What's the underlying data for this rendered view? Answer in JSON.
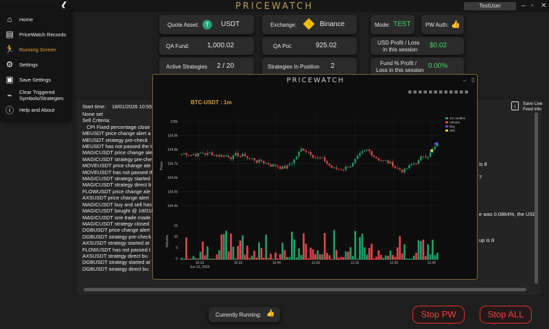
{
  "header": {
    "brand": "PRICEWATCH",
    "user": "TestUser",
    "back_icon": "chevron-left-icon"
  },
  "cards": {
    "quote_asset": {
      "label": "Quote Asset:",
      "value": "USDT"
    },
    "exchange": {
      "label": "Exchange:",
      "value": "Binance"
    },
    "mode": {
      "label": "Mode:",
      "value": "TEST"
    },
    "pw_auth": {
      "label": "PW Auth:"
    },
    "qa_fund": {
      "label": "QA Fund:",
      "value": "1,000.02"
    },
    "qa_pot": {
      "label": "QA Pot:",
      "value": "925.02"
    },
    "usd_pl": {
      "label1": "USD Profit / Loss",
      "label2": "in this session",
      "value": "$0.02"
    },
    "active": {
      "label": "Active Strategies",
      "value": "2 / 20"
    },
    "in_position": {
      "label": "Strategies In Position",
      "value": "2"
    },
    "fund_pl": {
      "label1": "Fund % Profit /",
      "label2": "Loss in this session",
      "value": "0.00%"
    }
  },
  "sidebar": {
    "items": [
      {
        "label": "Home",
        "icon": "home-icon"
      },
      {
        "label": "PriceWatch Records",
        "icon": "document-icon"
      },
      {
        "label": "Running Screen",
        "icon": "runner-icon"
      },
      {
        "label": "Settings",
        "icon": "gear-icon"
      },
      {
        "label": "Save Settings",
        "icon": "save-icon"
      },
      {
        "label1": "Clear Triggered",
        "label2": "Symbols/Strategies",
        "icon": "broom-icon"
      },
      {
        "label": "Help and About",
        "icon": "info-icon"
      }
    ]
  },
  "log": {
    "start_label": "Start time:",
    "start_value": "18/01/2026 10:55:3",
    "lines": [
      "None set",
      "Sell Criteria:",
      "   CPI Fixed percentage close",
      "",
      "",
      "MEUSDT price change alert a",
      "MEUSDT strategy pre-check",
      "MEUSDT has not passed the t",
      "MAGICUSDT price change ale",
      "MAGICUSDT strategy pre-che",
      "MOVEUSDT price change ale",
      "MOVEUSDT has not passed th",
      "MAGICUSDT strategy started",
      "MAGICUSDT strategy direct b",
      "FLOWUSDT price change ale",
      "AXSUSDT price change alert",
      "MAGICUSDT buy and sell has",
      "MAGICUSDT bought @ 18/01/",
      "MAGICUSDT one trade made",
      "MAGICUSDT strategy closed",
      "DGBUSDT price change alert",
      "DGBUSDT strategy pre-check",
      "AXSUSDT strategy started at",
      "FLOWUSDT has not passed t",
      "AXSUSDT strategy direct bu",
      "DGBUSDT strategy started at",
      "DGBUSDT strategy direct bu"
    ],
    "right1": "is 8",
    "right2": "7",
    "right3": "e was 0.0864%, the USD",
    "right4": "up is 8",
    "save_live1": "Save Live",
    "save_live2": "Feed info"
  },
  "chart_window": {
    "title": "PRICEWATCH"
  },
  "chart_data": {
    "type": "candlestick",
    "title": "BTC-USDT : 1m",
    "ylabel": "Price",
    "ylabel2": "Volume",
    "ylim": [
      104450,
      105050
    ],
    "price_ticks": [
      "105k",
      "104.9k",
      "104.8k",
      "104.7k",
      "104.6k",
      "104.5k",
      "104.4k"
    ],
    "vol_ticks": [
      "15",
      "10",
      "5",
      "0"
    ],
    "vol_ylim": [
      0,
      16
    ],
    "x_ticks": [
      "10:15",
      "10:30",
      "10:45",
      "11:00",
      "11:15",
      "11:30",
      "11:45"
    ],
    "x_date": "Jun 13, 2025",
    "legend": [
      "1m candles",
      "Volume",
      "Buy",
      "Sell"
    ],
    "colors": {
      "up": "#1f9e6a",
      "down": "#e0454a",
      "buy": "#6a4cff",
      "sell": "#f0d020"
    }
  },
  "footer": {
    "running_label": "Currently Running:",
    "stop_pw": "Stop PW",
    "stop_all": "Stop ALL"
  }
}
